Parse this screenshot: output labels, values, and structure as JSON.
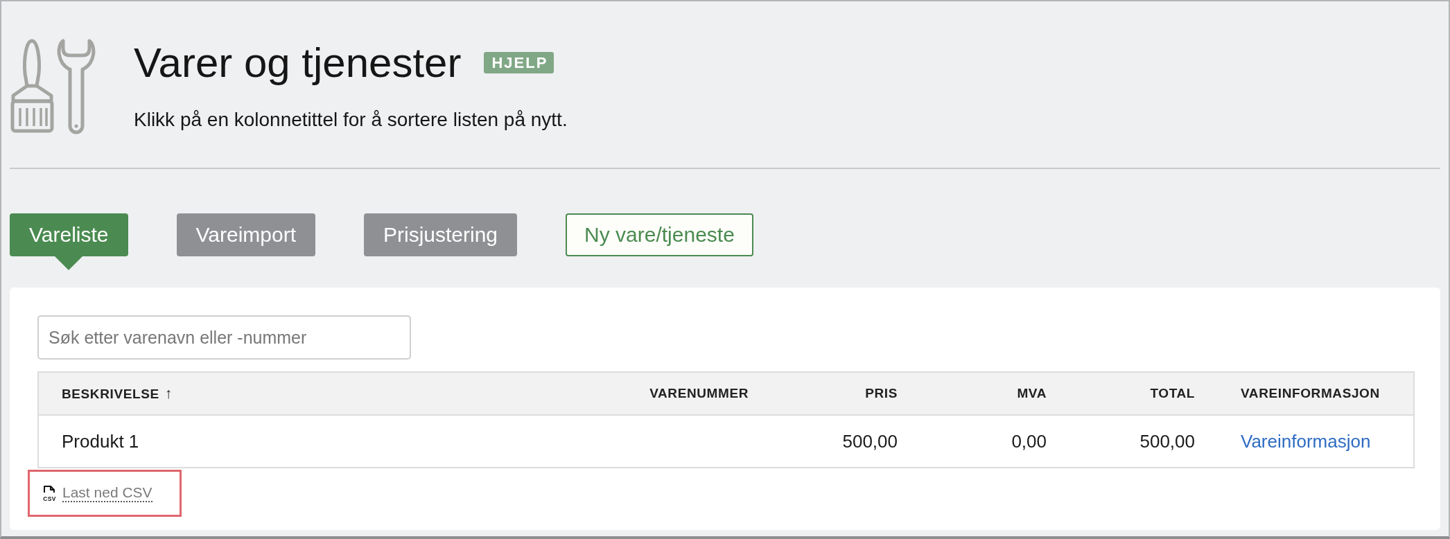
{
  "header": {
    "title": "Varer og tjenester",
    "help_badge": "HJELP",
    "subtitle": "Klikk på en kolonnetittel for å sortere listen på nytt."
  },
  "tabs": [
    {
      "label": "Vareliste",
      "selected": true
    },
    {
      "label": "Vareimport",
      "selected": false
    },
    {
      "label": "Prisjustering",
      "selected": false
    }
  ],
  "new_item_button": {
    "label": "Ny vare/tjeneste"
  },
  "search": {
    "placeholder": "Søk etter varenavn eller -nummer"
  },
  "table": {
    "columns": [
      {
        "label": "BESKRIVELSE",
        "kind": "text",
        "sort_indicator": "↑"
      },
      {
        "label": "VARENUMMER",
        "kind": "number"
      },
      {
        "label": "PRIS",
        "kind": "number"
      },
      {
        "label": "MVA",
        "kind": "number"
      },
      {
        "label": "TOTAL",
        "kind": "number"
      },
      {
        "label": "VAREINFORMASJON",
        "kind": "link"
      }
    ],
    "rows": [
      {
        "cells": [
          "Produkt 1",
          null,
          "500,00",
          "0,00",
          "500,00",
          "Vareinformasjon"
        ]
      }
    ]
  },
  "download": {
    "label": "Last ned CSV",
    "icon_text": "CSV",
    "highlighted": true
  }
}
